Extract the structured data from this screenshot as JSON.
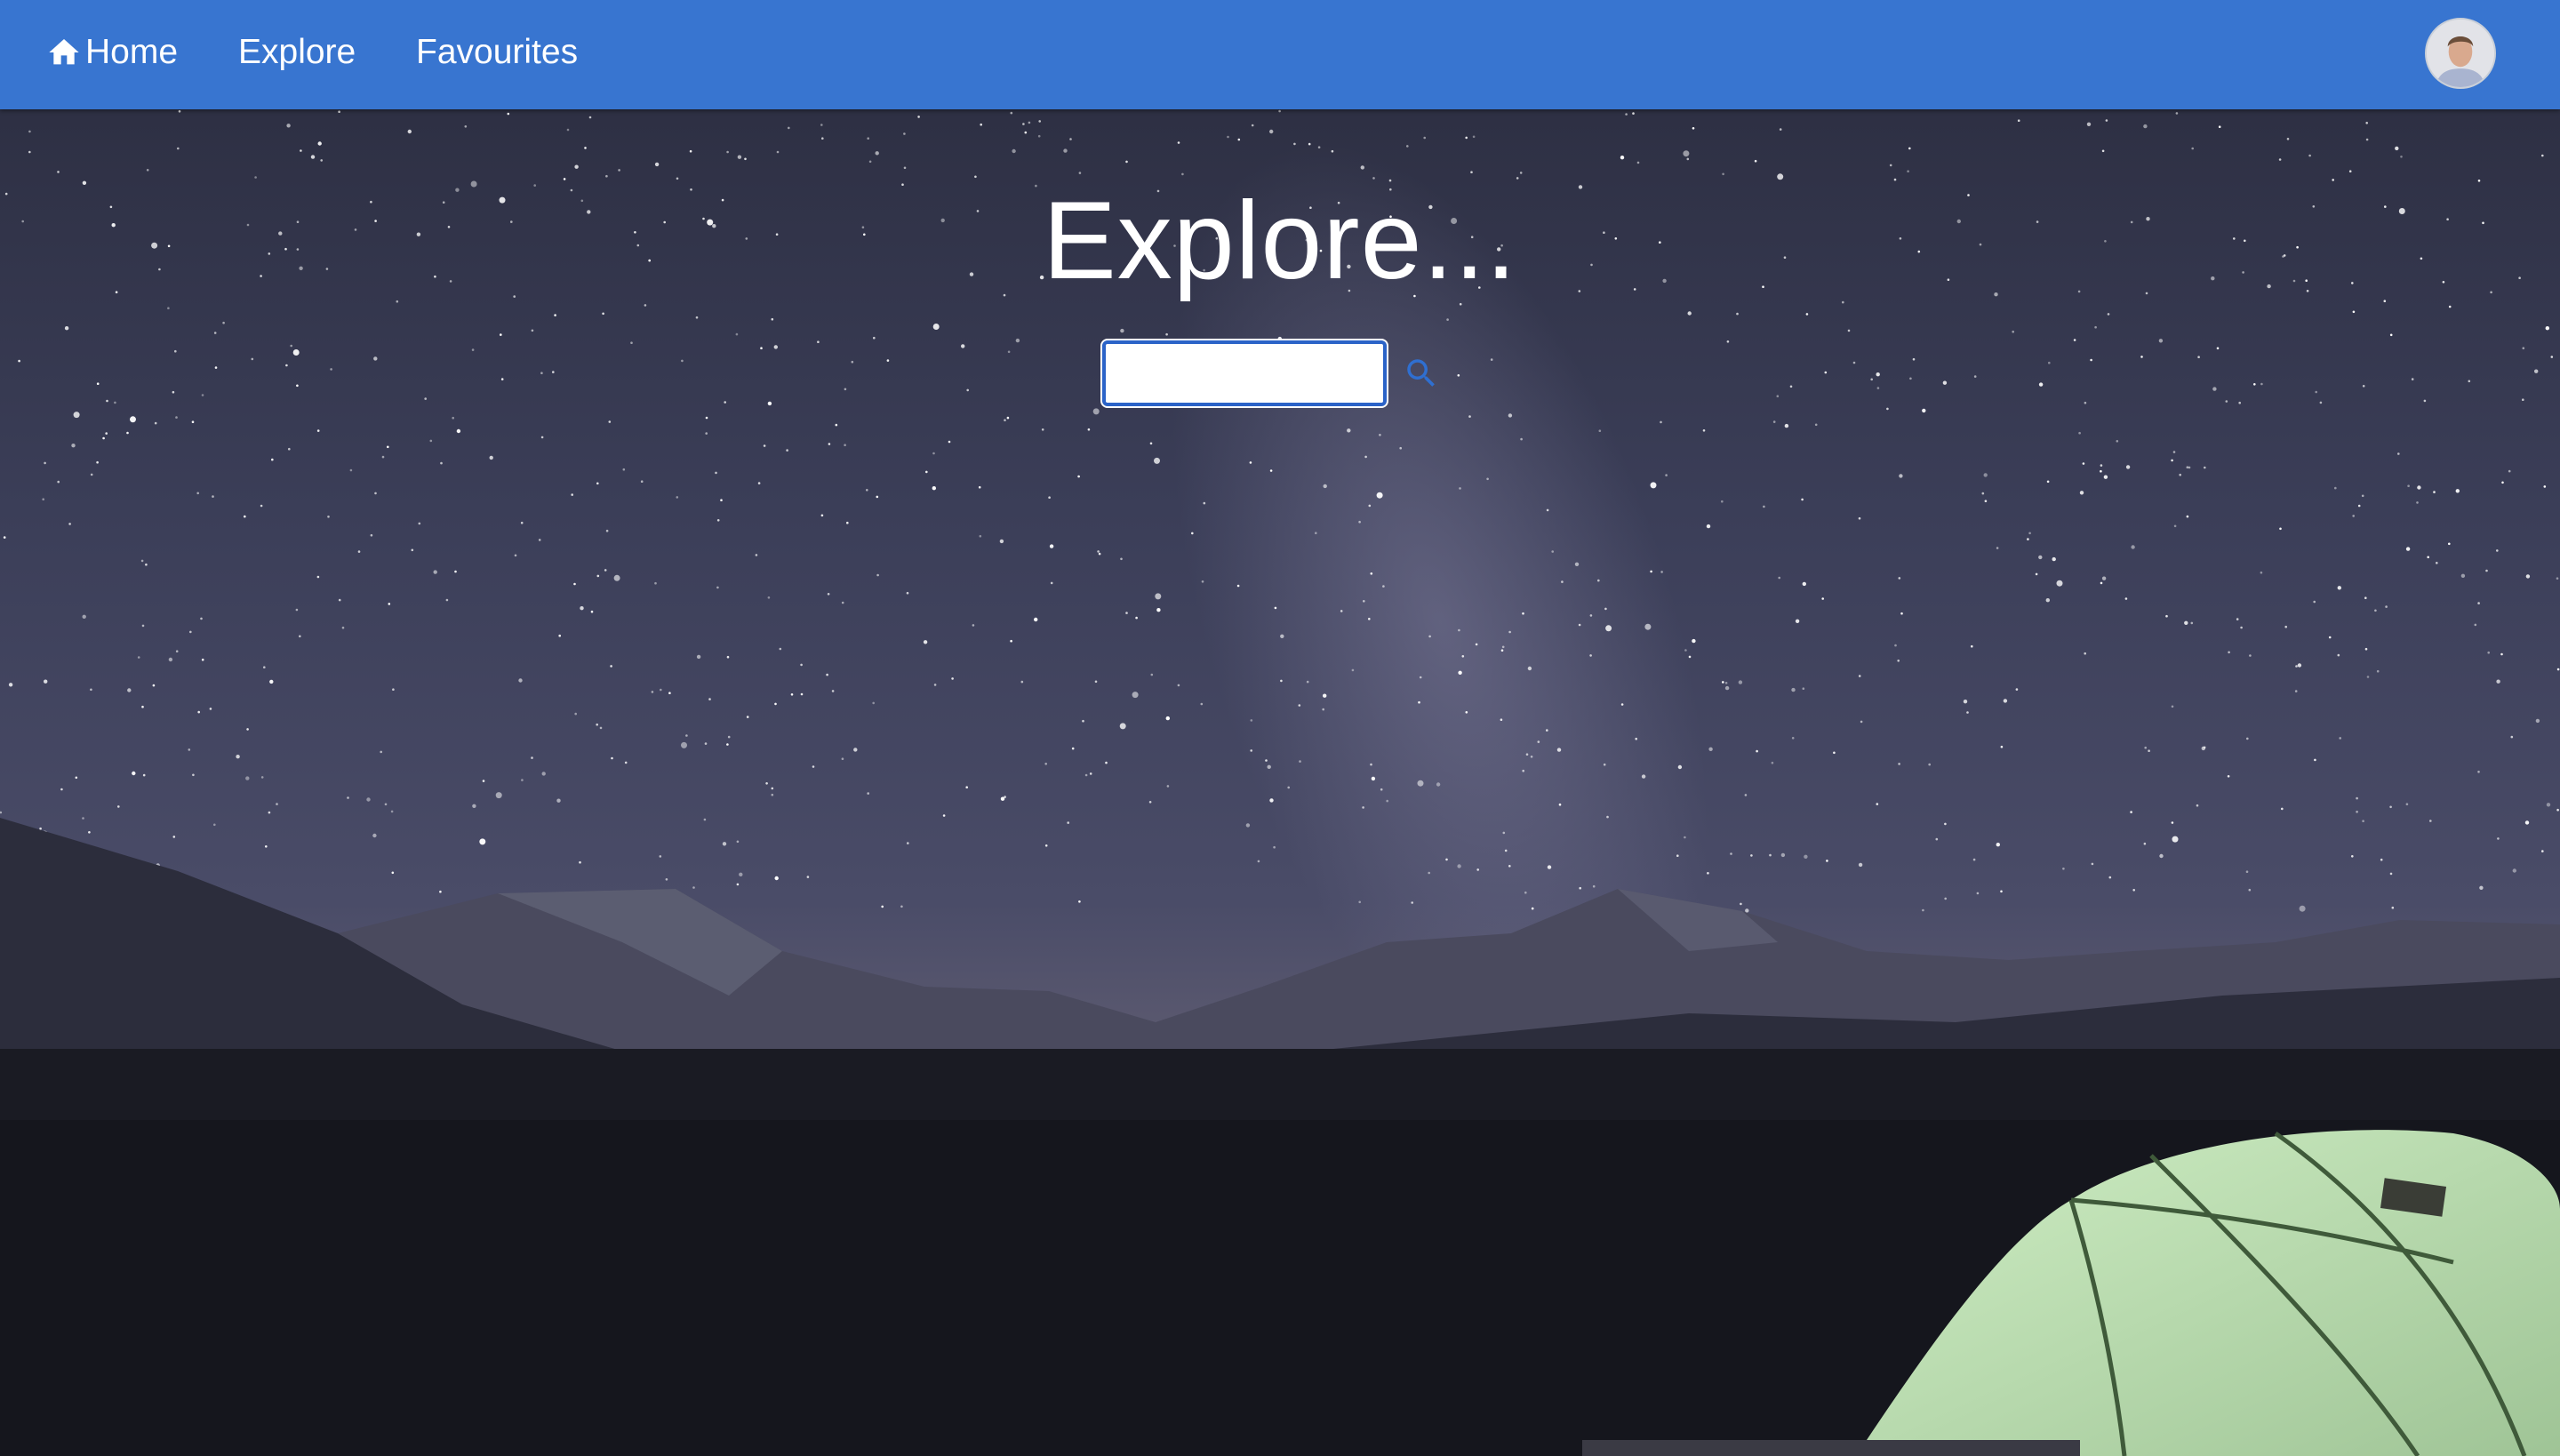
{
  "nav": {
    "items": [
      {
        "label": "Home",
        "icon": "home-icon"
      },
      {
        "label": "Explore"
      },
      {
        "label": "Favourites"
      }
    ],
    "avatar_icon": "user-avatar"
  },
  "hero": {
    "title": "Explore...",
    "search_value": "",
    "search_icon": "search-icon"
  },
  "colors": {
    "nav_bg": "#3875d0",
    "accent": "#2b63c8"
  }
}
